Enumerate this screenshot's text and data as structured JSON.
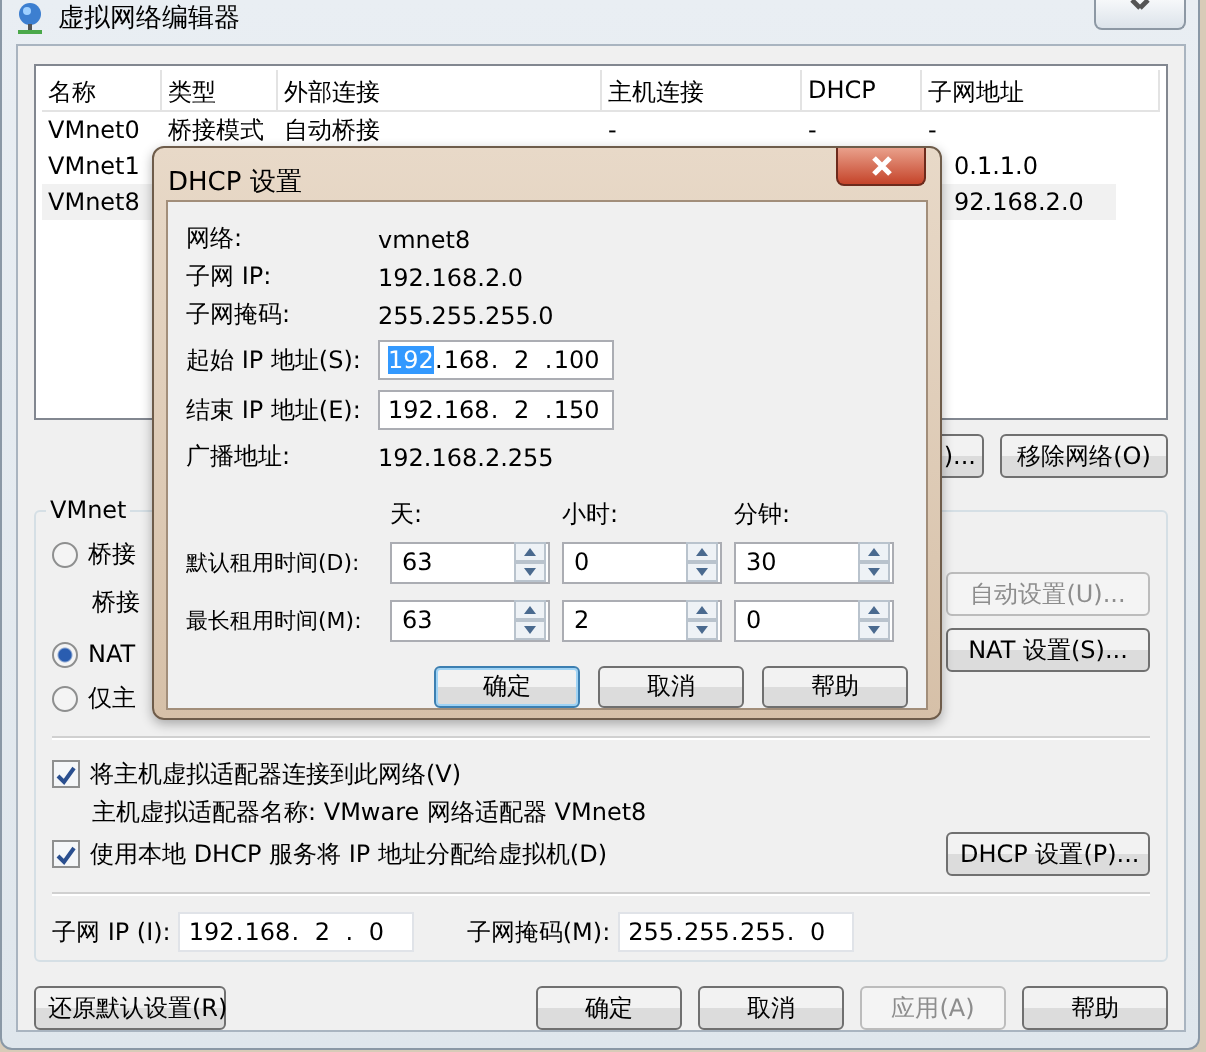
{
  "window": {
    "title": "虚拟网络编辑器"
  },
  "network_table": {
    "columns": [
      "名称",
      "类型",
      "外部连接",
      "主机连接",
      "DHCP",
      "子网地址"
    ],
    "rows": [
      {
        "name": "VMnet0",
        "type": "桥接模式",
        "external": "自动桥接",
        "host": "-",
        "dhcp": "-",
        "subnet": "-",
        "selected": false
      },
      {
        "name": "VMnet1",
        "subnet": "0.1.1.0",
        "selected": false
      },
      {
        "name": "VMnet8",
        "subnet": "92.168.2.0",
        "selected": true
      }
    ]
  },
  "table_buttons": [
    {
      "label": ")..."
    },
    {
      "label": "移除网络(O)"
    }
  ],
  "vmnet_info": {
    "title": "VMnet",
    "modes": [
      {
        "label": "桥接",
        "selected": false
      },
      {
        "label": "NAT",
        "selected": true
      },
      {
        "label": "仅主",
        "selected": false
      }
    ],
    "bridge_label": "桥接",
    "auto_button": {
      "label": "自动设置(U)...",
      "disabled": true
    },
    "nat_button": {
      "label": "NAT 设置(S)...",
      "disabled": false
    },
    "connect_adapter": {
      "label": "将主机虚拟适配器连接到此网络(V)",
      "checked": true
    },
    "adapter_name": "主机虚拟适配器名称: VMware 网络适配器 VMnet8",
    "use_dhcp": {
      "label": "使用本地 DHCP 服务将 IP 地址分配给虚拟机(D)",
      "checked": true
    },
    "dhcp_button": {
      "label": "DHCP 设置(P)...",
      "disabled": false
    },
    "subnet_ip": {
      "label": "子网 IP (I):",
      "separator": ".",
      "octets": [
        "192",
        "168",
        "2",
        "0"
      ]
    },
    "subnet_mask": {
      "label": "子网掩码(M):",
      "separator": ".",
      "octets": [
        "255",
        "255",
        "255",
        "0"
      ]
    }
  },
  "footer_buttons": [
    {
      "label": "还原默认设置(R)",
      "disabled": false
    },
    {
      "label": "确定",
      "disabled": false
    },
    {
      "label": "取消",
      "disabled": false
    },
    {
      "label": "应用(A)",
      "disabled": true
    },
    {
      "label": "帮助",
      "disabled": false
    }
  ],
  "dhcp_dialog": {
    "title": "DHCP 设置",
    "info": [
      {
        "label": "网络:",
        "value": "vmnet8"
      },
      {
        "label": "子网 IP:",
        "value": "192.168.2.0"
      },
      {
        "label": "子网掩码:",
        "value": "255.255.255.0"
      }
    ],
    "ranges": [
      {
        "label": "起始 IP 地址(S):",
        "separator": ".",
        "octets": [
          {
            "value": "192",
            "selected": true
          },
          {
            "value": "168",
            "selected": false
          },
          {
            "value": "2",
            "selected": false
          },
          {
            "value": "100",
            "selected": false
          }
        ]
      },
      {
        "label": "结束 IP 地址(E):",
        "separator": ".",
        "octets": [
          {
            "value": "192",
            "selected": false
          },
          {
            "value": "168",
            "selected": false
          },
          {
            "value": "2",
            "selected": false
          },
          {
            "value": "150",
            "selected": false
          }
        ]
      }
    ],
    "broadcast": {
      "label": "广播地址:",
      "value": "192.168.2.255"
    },
    "lease_columns": [
      "天:",
      "小时:",
      "分钟:"
    ],
    "leases": [
      {
        "label": "默认租用时间(D):",
        "values": [
          "63",
          "0",
          "30"
        ]
      },
      {
        "label": "最长租用时间(M):",
        "values": [
          "63",
          "2",
          "0"
        ]
      }
    ],
    "buttons": [
      {
        "label": "确定",
        "default": true
      },
      {
        "label": "取消",
        "default": false
      },
      {
        "label": "帮助",
        "default": false
      }
    ]
  }
}
